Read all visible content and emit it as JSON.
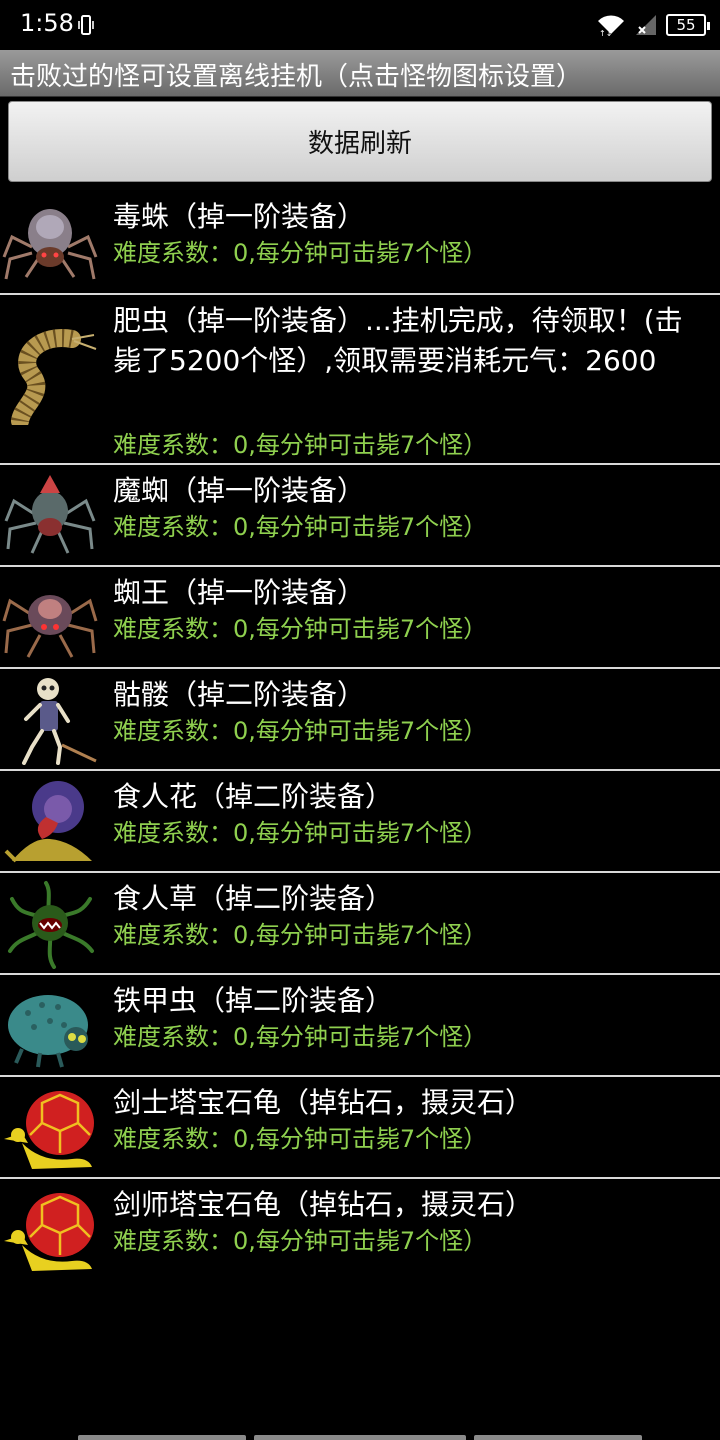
{
  "status_bar": {
    "time": "1:58",
    "battery": "55",
    "icons": [
      "vibrate-icon",
      "wifi-icon",
      "signal-icon",
      "battery-icon"
    ]
  },
  "header": {
    "title": "击败过的怪可设置离线挂机（点击怪物图标设置）"
  },
  "refresh_button": {
    "label": "数据刷新"
  },
  "monsters": [
    {
      "name": "毒蛛（掉一阶装备）",
      "difficulty": "难度系数：0,每分钟可击毙7个怪）",
      "icon": "spider-icon"
    },
    {
      "name": "肥虫（掉一阶装备）...挂机完成，待领取！(击毙了5200个怪）,领取需要消耗元气：2600",
      "difficulty": "难度系数：0,每分钟可击毙7个怪）",
      "icon": "worm-icon"
    },
    {
      "name": "魔蜘（掉一阶装备）",
      "difficulty": "难度系数：0,每分钟可击毙7个怪）",
      "icon": "demon-spider-icon"
    },
    {
      "name": "蜘王（掉一阶装备）",
      "difficulty": "难度系数：0,每分钟可击毙7个怪）",
      "icon": "spider-king-icon"
    },
    {
      "name": "骷髅（掉二阶装备）",
      "difficulty": "难度系数：0,每分钟可击毙7个怪）",
      "icon": "skeleton-icon"
    },
    {
      "name": "食人花（掉二阶装备）",
      "difficulty": "难度系数：0,每分钟可击毙7个怪）",
      "icon": "man-eating-flower-icon"
    },
    {
      "name": "食人草（掉二阶装备）",
      "difficulty": "难度系数：0,每分钟可击毙7个怪）",
      "icon": "man-eating-grass-icon"
    },
    {
      "name": "铁甲虫（掉二阶装备）",
      "difficulty": "难度系数：0,每分钟可击毙7个怪）",
      "icon": "armored-beetle-icon"
    },
    {
      "name": "剑士塔宝石龟（掉钻石，摄灵石）",
      "difficulty": "难度系数：0,每分钟可击毙7个怪）",
      "icon": "gem-turtle-icon"
    },
    {
      "name": "剑师塔宝石龟（掉钻石，摄灵石）",
      "difficulty": "难度系数：0,每分钟可击毙7个怪）",
      "icon": "gem-turtle-icon"
    }
  ]
}
